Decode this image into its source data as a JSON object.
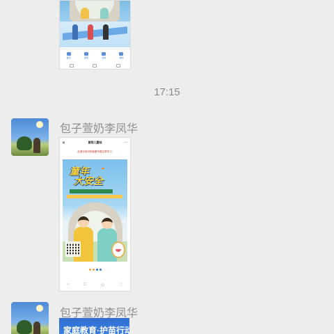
{
  "timestamp": "17:15",
  "messages": [
    {
      "sender": "包子萱奶李凤华",
      "image": {
        "header_title": "冒险儿童站",
        "subtitle": "",
        "notice": "赶紧长按识别观看专题文章学习!",
        "poster_headline": [
          "童年",
          "大安全"
        ],
        "poster_tag": "",
        "bottom_icons": [
          "back-icon",
          "home-icon",
          "share-icon",
          "favorite-icon"
        ]
      }
    },
    {
      "sender": "包子萱奶李凤华",
      "image": {
        "headline": "家庭教育·护苗行动"
      }
    }
  ],
  "top_image": {
    "tabs": [
      "首页",
      "发现",
      "活动",
      "我的"
    ]
  },
  "colors": {
    "background": "#ededed",
    "poster_yellow": "#ffd23a",
    "poster_blue": "#7cc0ec",
    "bottom_banner": "#2f6fd1"
  }
}
